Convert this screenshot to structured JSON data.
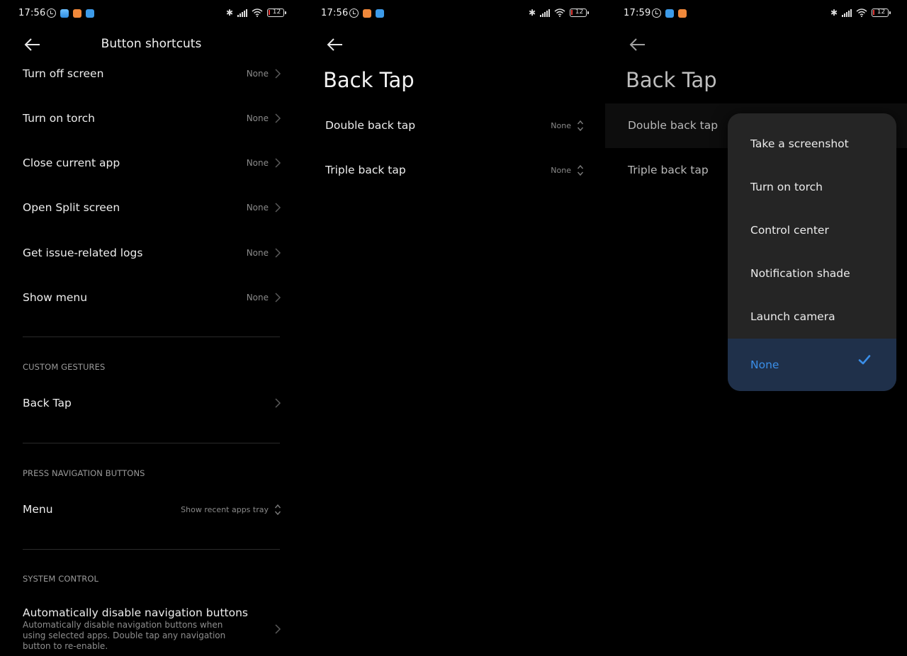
{
  "screens": [
    {
      "status_bar": {
        "time": "17:56",
        "notification_icons": [
          "alarm-icon",
          "weather-app-icon",
          "orange-app-icon",
          "telegram-app-icon"
        ],
        "battery": "12"
      },
      "header": {
        "title": "Button shortcuts",
        "back_icon": "arrow-left-icon"
      },
      "shortcut_rows": [
        {
          "label": "Turn off screen",
          "value": "None"
        },
        {
          "label": "Turn on torch",
          "value": "None"
        },
        {
          "label": "Close current app",
          "value": "None"
        },
        {
          "label": "Open Split screen",
          "value": "None"
        },
        {
          "label": "Get issue-related logs",
          "value": "None"
        },
        {
          "label": "Show menu",
          "value": "None"
        }
      ],
      "sections": {
        "custom_gestures": {
          "header": "CUSTOM GESTURES",
          "item": "Back Tap"
        },
        "press_navigation": {
          "header": "PRESS NAVIGATION BUTTONS",
          "item": "Menu",
          "value": "Show recent apps tray"
        },
        "system_control": {
          "header": "SYSTEM CONTROL",
          "item_title": "Automatically disable navigation buttons",
          "item_subtitle": "Automatically disable navigation buttons when using selected apps. Double tap any navigation button to re-enable."
        }
      }
    },
    {
      "status_bar": {
        "time": "17:56",
        "notification_icons": [
          "alarm-icon",
          "orange-app-icon",
          "telegram-app-icon"
        ],
        "battery": "12"
      },
      "header": {
        "title": "Back Tap",
        "back_icon": "arrow-left-icon"
      },
      "rows": [
        {
          "label": "Double back tap",
          "value": "None"
        },
        {
          "label": "Triple back tap",
          "value": "None"
        }
      ]
    },
    {
      "status_bar": {
        "time": "17:59",
        "notification_icons": [
          "alarm-icon",
          "telegram-app-icon",
          "orange-app-icon"
        ],
        "battery": "12"
      },
      "header": {
        "title": "Back Tap",
        "back_icon": "arrow-left-icon"
      },
      "rows": [
        {
          "label": "Double back tap"
        },
        {
          "label": "Triple back tap"
        }
      ],
      "popup": {
        "options": [
          "Take a screenshot",
          "Turn on torch",
          "Control center",
          "Notification shade",
          "Launch camera",
          "None"
        ],
        "selected": "None"
      }
    }
  ],
  "colors": {
    "background": "#000000",
    "accent": "#3a8ee8",
    "selected_bg": "#1f304a",
    "popup_bg": "#252525",
    "weather_app": "#4aa3f0",
    "orange_app": "#f0883a",
    "telegram_app": "#3d9be9",
    "battery_low": "#e53935"
  }
}
